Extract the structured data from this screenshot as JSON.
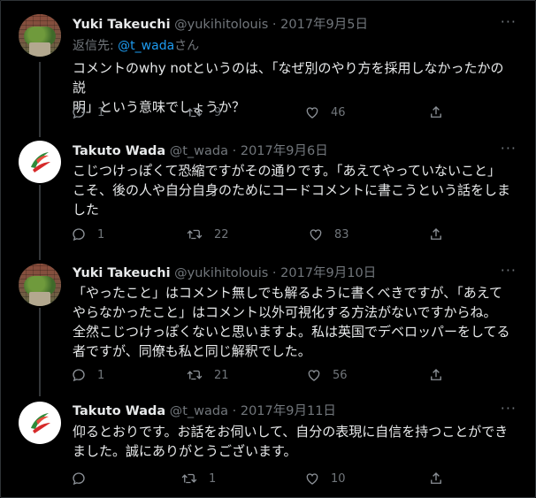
{
  "tweets": [
    {
      "author": "Yuki Takeuchi",
      "handle": "@yukihitolouis",
      "date": "2017年9月5日",
      "reply_prefix": "返信先: ",
      "reply_mention": "@t_wada",
      "reply_suffix": "さん",
      "lines": [
        "コメントのwhy notというのは、「なぜ別のやり方を採用しなかったかの説",
        "明」という意味でしょうか？"
      ],
      "reply_count": "1",
      "retweet_count": "9",
      "like_count": "46"
    },
    {
      "author": "Takuto Wada",
      "handle": "@t_wada",
      "date": "2017年9月6日",
      "lines": [
        "こじつけっぽくて恐縮ですがその通りです。「あえてやっていないこと」",
        "こそ、後の人や自分自身のためにコードコメントに書こうという話をしま",
        "した"
      ],
      "reply_count": "1",
      "retweet_count": "22",
      "like_count": "83"
    },
    {
      "author": "Yuki Takeuchi",
      "handle": "@yukihitolouis",
      "date": "2017年9月10日",
      "lines": [
        "「やったこと」はコメント無しでも解るように書くべきですが、「あえて",
        "やらなかったこと」はコメント以外可視化する方法がないですからね。",
        "全然こじつけっぽくないと思いますよ。私は英国でデベロッパーをしてる",
        "者ですが、同僚も私と同じ解釈でした。"
      ],
      "reply_count": "1",
      "retweet_count": "21",
      "like_count": "56"
    },
    {
      "author": "Takuto Wada",
      "handle": "@t_wada",
      "date": "2017年9月11日",
      "lines": [
        "仰るとおりです。お話をお伺いして、自分の表現に自信を持つことができ",
        "ました。誠にありがとうございます。"
      ],
      "reply_count": "",
      "retweet_count": "1",
      "like_count": "10"
    }
  ],
  "common": {
    "separator": " · ",
    "more_label": "···"
  },
  "icons": [
    "reply-icon",
    "retweet-icon",
    "like-icon",
    "share-icon",
    "more-icon"
  ],
  "colors": {
    "background": "#000000",
    "text": "#e7e9ea",
    "muted": "#71767b",
    "link": "#1d9bf0"
  }
}
